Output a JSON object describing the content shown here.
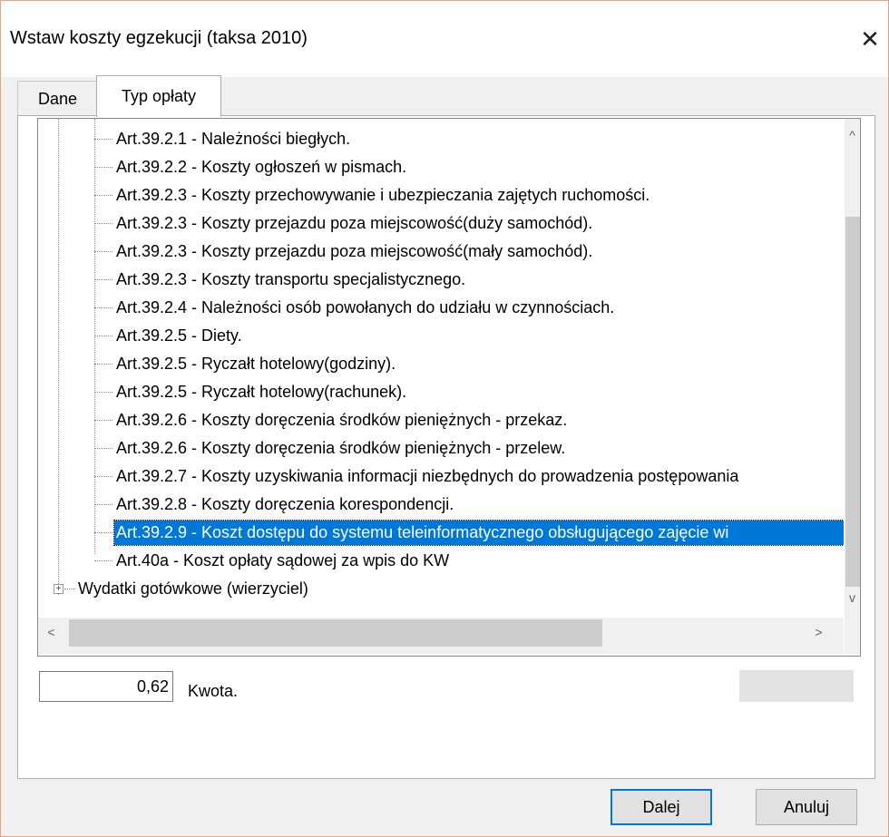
{
  "window": {
    "title": "Wstaw koszty egzekucji (taksa 2010)",
    "close_glyph": "✕"
  },
  "tabs": [
    {
      "label": "Dane",
      "active": false
    },
    {
      "label": "Typ opłaty",
      "active": true
    }
  ],
  "tree": {
    "items": [
      {
        "label": "Art.39.2.1 - Należności biegłych.",
        "selected": false
      },
      {
        "label": "Art.39.2.2 - Koszty ogłoszeń w pismach.",
        "selected": false
      },
      {
        "label": "Art.39.2.3 - Koszty przechowywanie i ubezpieczania zajętych ruchomości.",
        "selected": false
      },
      {
        "label": "Art.39.2.3 - Koszty przejazdu poza miejscowość(duży samochód).",
        "selected": false
      },
      {
        "label": "Art.39.2.3 - Koszty przejazdu poza miejscowość(mały samochód).",
        "selected": false
      },
      {
        "label": "Art.39.2.3 - Koszty transportu specjalistycznego.",
        "selected": false
      },
      {
        "label": "Art.39.2.4 - Należności osób powołanych do udziału w czynnościach.",
        "selected": false
      },
      {
        "label": "Art.39.2.5 - Diety.",
        "selected": false
      },
      {
        "label": "Art.39.2.5 - Ryczałt hotelowy(godziny).",
        "selected": false
      },
      {
        "label": "Art.39.2.5 - Ryczałt hotelowy(rachunek).",
        "selected": false
      },
      {
        "label": "Art.39.2.6 - Koszty doręczenia środków pieniężnych - przekaz.",
        "selected": false
      },
      {
        "label": "Art.39.2.6 - Koszty doręczenia środków pieniężnych - przelew.",
        "selected": false
      },
      {
        "label": "Art.39.2.7 - Koszty uzyskiwania informacji niezbędnych do prowadzenia postępowania",
        "selected": false
      },
      {
        "label": "Art.39.2.8 - Koszty doręczenia korespondencji.",
        "selected": false
      },
      {
        "label": "Art.39.2.9 - Koszt dostępu do systemu teleinformatycznego obsługującego zajęcie wi",
        "selected": true
      },
      {
        "label": "Art.40a - Koszt opłaty sądowej za wpis do KW",
        "selected": false
      }
    ],
    "group": {
      "label": "Wydatki gotówkowe (wierzyciel)",
      "expander": "+"
    },
    "scroll": {
      "up": "^",
      "down": "v",
      "left": "<",
      "right": ">"
    }
  },
  "amount": {
    "value": "0,62",
    "label": "Kwota."
  },
  "buttons": {
    "next": "Dalej",
    "cancel": "Anuluj"
  },
  "colors": {
    "selection": "#0078d7",
    "window_border": "#e8a37d"
  }
}
